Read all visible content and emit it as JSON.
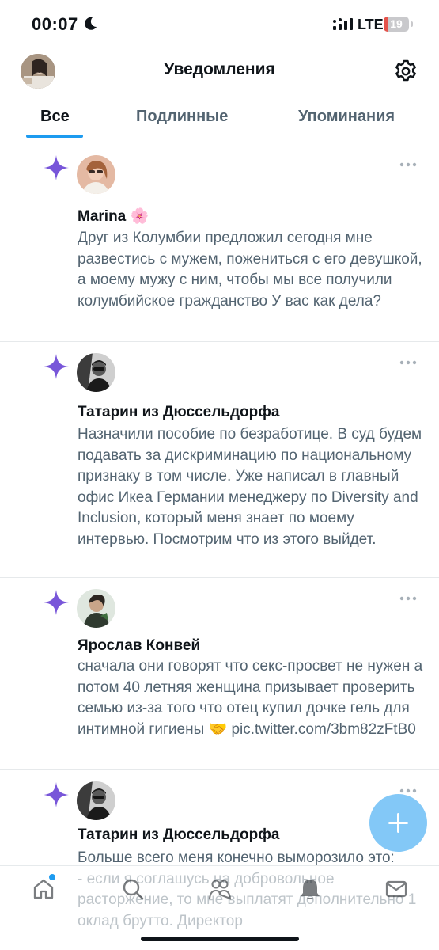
{
  "status_bar": {
    "time": "00:07",
    "network": "LTE",
    "battery_level": "19",
    "battery_fraction": 0.19
  },
  "header": {
    "title": "Уведомления",
    "settings_icon": "gear-icon"
  },
  "tabs": [
    {
      "label": "Все",
      "active": true
    },
    {
      "label": "Подлинные",
      "active": false
    },
    {
      "label": "Упоминания",
      "active": false
    }
  ],
  "notifications": [
    {
      "name": "Marina 🌸",
      "text": "Друг из Колумбии предложил сегодня мне развестись с мужем, пожениться с его девушкой, а моему мужу с ним, чтобы мы все получили колумбийское гражданство У вас как дела?"
    },
    {
      "name": "Татарин из Дюссельдорфа",
      "text": "Назначили пособие по безработице. В суд будем подавать за дискриминацию по национальному признаку в том числе. Уже написал в главный офис Икеа Германии менеджеру по Diversity and Inclusion, который меня знает по моему интервью. Посмотрим что из этого выйдет."
    },
    {
      "name": "Ярослав Конвей",
      "text": "сначала они говорят что секс-просвет не нужен а потом 40 летняя женщина призывает проверить семью из-за того что отец купил дочке гель для интимной гигиены 🤝 pic.twitter.com/3bm82zFtB0"
    },
    {
      "name": "Татарин из Дюссельдорфа",
      "text": "Больше всего меня конечно выморозило это:\n- если я соглашусь на добровольное расторжение, то мне выплатят дополнительно 1 оклад брутто. Директор"
    }
  ],
  "bottom_nav": [
    {
      "icon": "home-icon"
    },
    {
      "icon": "search-icon"
    },
    {
      "icon": "communities-icon"
    },
    {
      "icon": "bell-icon"
    },
    {
      "icon": "mail-icon"
    }
  ],
  "fab_icon": "plus-icon",
  "colors": {
    "accent": "#1d9bf0",
    "sparkle": "#7856d9",
    "secondary_text": "#536471"
  }
}
